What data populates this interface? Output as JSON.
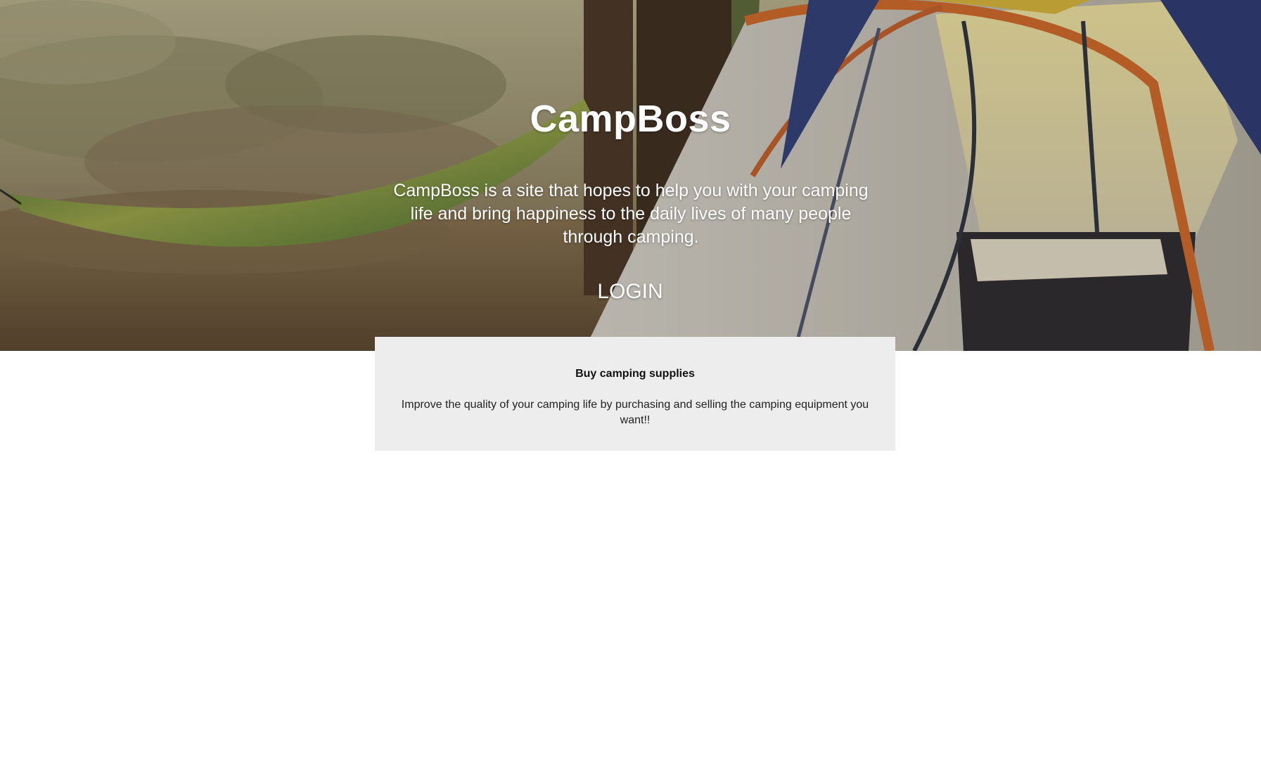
{
  "hero": {
    "title": "CampBoss",
    "description": "CampBoss is a site that hopes to help you with your camping life and bring happiness to the daily lives of many people through camping.",
    "login_label": "LOGIN"
  },
  "card": {
    "title": "Buy camping supplies",
    "text": "Improve the quality of your camping life by purchasing and selling the camping equipment you want!!"
  },
  "colors": {
    "card_background": "#ededed",
    "hero_text": "#ffffff"
  }
}
